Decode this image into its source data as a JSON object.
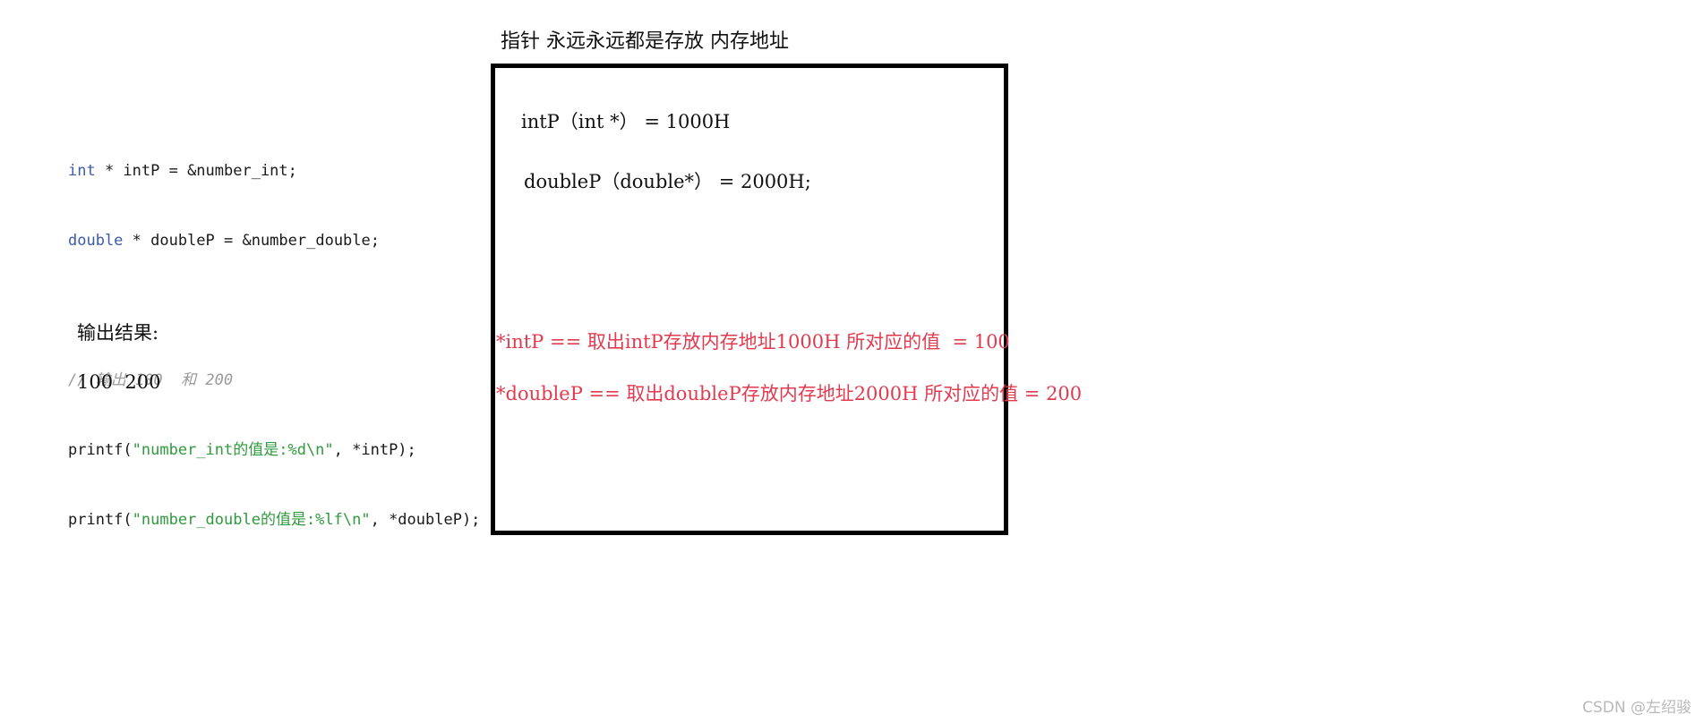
{
  "title": "指针 永远永远都是存放 内存地址",
  "code": {
    "line1_kw": "int",
    "line1_rest": " * intP = &number_int;",
    "line2_kw": "double",
    "line2_rest": " * doubleP = &number_double;",
    "comment": "// 输出 100  和 200",
    "line4_pre": "printf(",
    "line4_str": "\"number_int的值是:%d\\n\"",
    "line4_post": ", *intP);",
    "line5_pre": "printf(",
    "line5_str": "\"number_double的值是:%lf\\n\"",
    "line5_post": ", *doubleP);"
  },
  "output": {
    "label": "输出结果:",
    "values": "100  200"
  },
  "box": {
    "line1": "intP（int *） = 1000H",
    "line2": "doubleP（double*） = 2000H;"
  },
  "annotations": {
    "line1": "*intP == 取出intP存放内存地址1000H 所对应的值  = 100",
    "line2": "*doubleP == 取出doubleP存放内存地址2000H 所对应的值 = 200"
  },
  "watermark": "CSDN @左绍骏",
  "colors": {
    "keyword": "#3b5ba9",
    "string": "#2f9a3e",
    "comment": "#9a9a9a",
    "annotation": "#e23a4e",
    "box_border": "#000000"
  }
}
